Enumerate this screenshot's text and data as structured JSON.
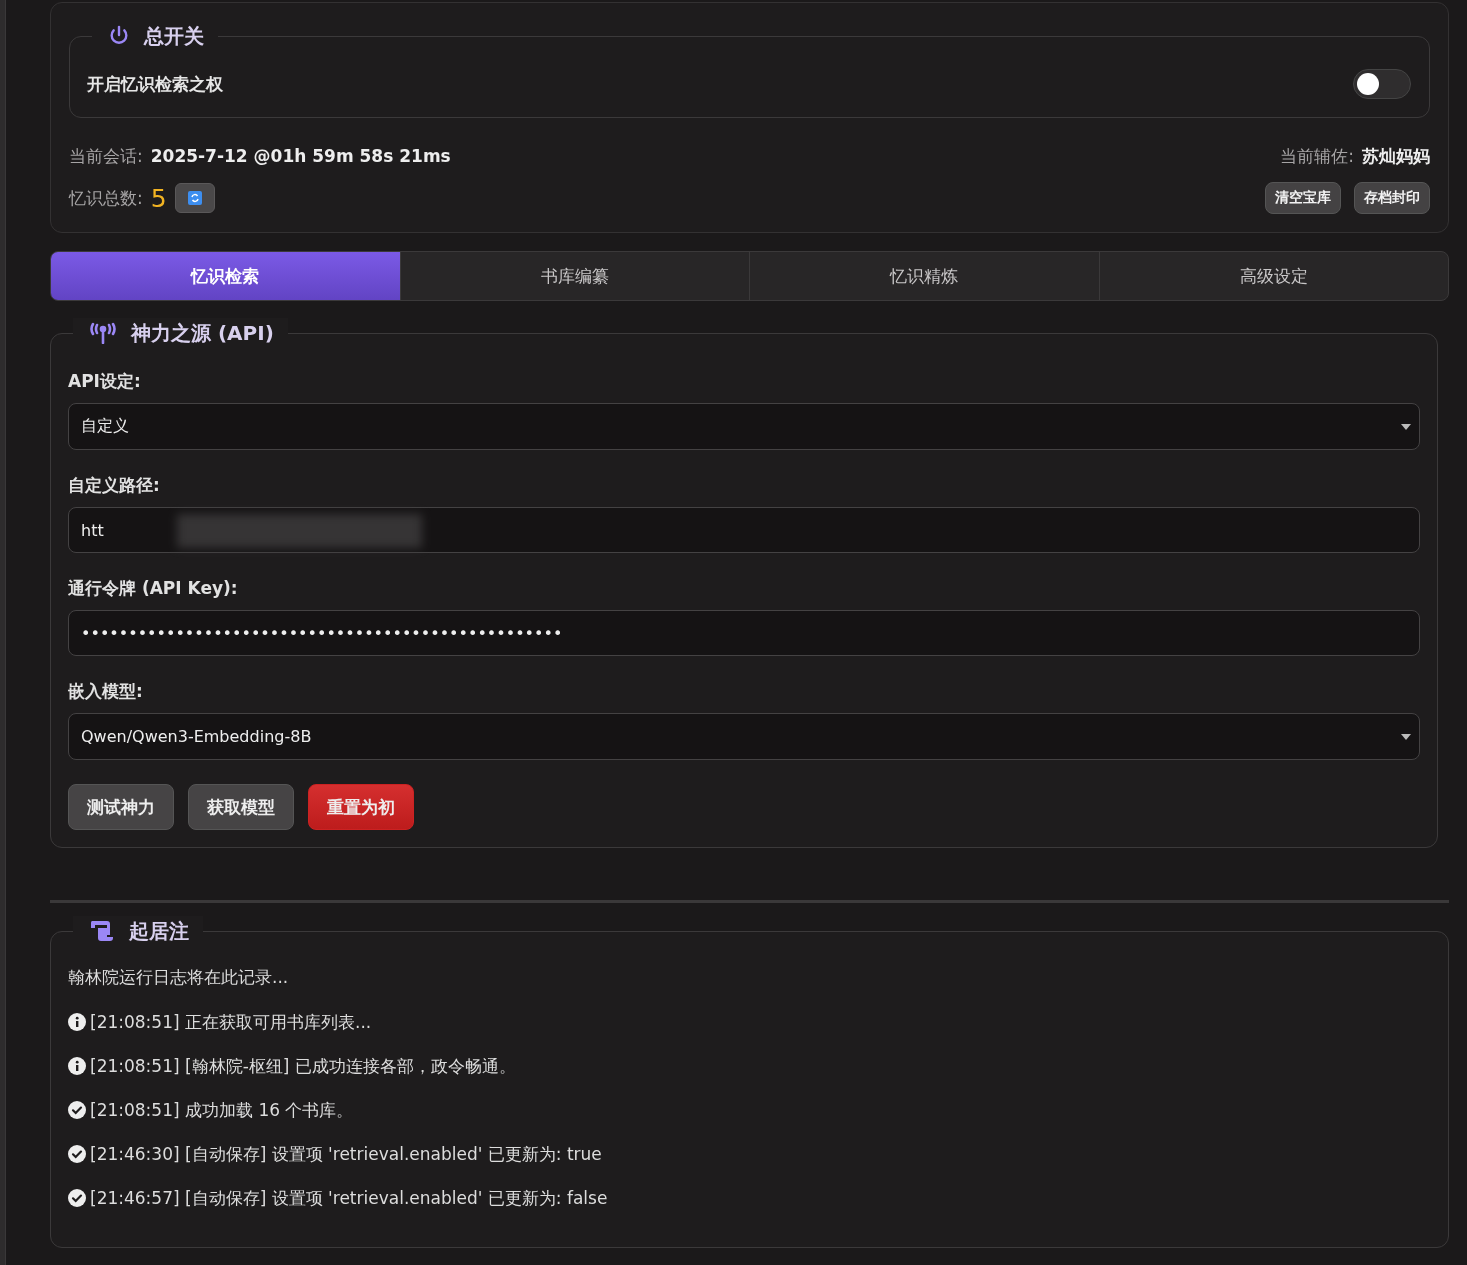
{
  "master_switch": {
    "title": "总开关",
    "label": "开启忆识检索之权",
    "on": false
  },
  "session": {
    "label": "当前会话:",
    "value": "2025-7-12 @01h 59m 58s 21ms"
  },
  "assistant": {
    "label": "当前辅佐:",
    "value": "苏灿妈妈"
  },
  "memory_count": {
    "label": "忆识总数:",
    "value": "5"
  },
  "actions": [
    "清空宝库",
    "存档封印"
  ],
  "tabs": [
    {
      "label": "忆识检索",
      "selected": true
    },
    {
      "label": "书库编纂",
      "selected": false
    },
    {
      "label": "忆识精炼",
      "selected": false
    },
    {
      "label": "高级设定",
      "selected": false
    }
  ],
  "api": {
    "title": "神力之源 (API)",
    "fields": [
      {
        "kind": "select",
        "label": "API设定:",
        "value": "自定义"
      },
      {
        "kind": "text",
        "label": "自定义路径:",
        "value": "htt"
      },
      {
        "kind": "text",
        "label": "通行令牌 (API Key):",
        "value": "•••••••••••••••••••••••••••••••••••••••••••••••••••"
      },
      {
        "kind": "select",
        "label": "嵌入模型:",
        "value": "Qwen/Qwen3-Embedding-8B"
      }
    ],
    "buttons": [
      {
        "label": "测试神力",
        "kind": "default"
      },
      {
        "label": "获取模型",
        "kind": "default"
      },
      {
        "label": "重置为初",
        "kind": "danger"
      }
    ]
  },
  "log": {
    "title": "起居注",
    "intro": "翰林院运行日志将在此记录...",
    "entries": [
      {
        "kind": "info",
        "text": "[21:08:51] 正在获取可用书库列表..."
      },
      {
        "kind": "info",
        "text": "[21:08:51] [翰林院-枢纽] 已成功连接各部，政令畅通。"
      },
      {
        "kind": "success",
        "text": "[21:08:51] 成功加载 16 个书库。"
      },
      {
        "kind": "success",
        "text": "[21:46:30] [自动保存] 设置项 'retrieval.enabled' 已更新为: true"
      },
      {
        "kind": "success",
        "text": "[21:46:57] [自动保存] 设置项 'retrieval.enabled' 已更新为: false"
      }
    ]
  }
}
